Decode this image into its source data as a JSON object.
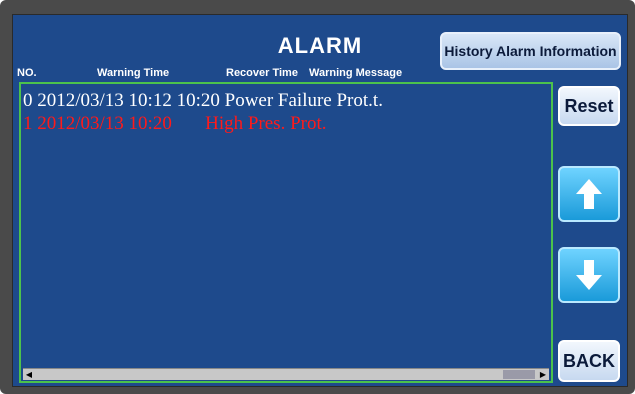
{
  "title": "ALARM",
  "history_button": "History Alarm Information",
  "columns": {
    "no": "NO.",
    "warning_time": "Warning Time",
    "recover_time": "Recover Time",
    "warning_message": "Warning Message"
  },
  "rows": [
    {
      "no": "0",
      "warning_time": "2012/03/13 10:12",
      "recover_time": "10:20",
      "message": "Power Failure Prot.t.",
      "color": "#ffffff"
    },
    {
      "no": "1",
      "warning_time": "2012/03/13 10:20",
      "recover_time": "",
      "message": "High Pres. Prot.",
      "color": "#ff1a1a"
    }
  ],
  "buttons": {
    "reset": "Reset",
    "up_icon": "arrow-up-icon",
    "down_icon": "arrow-down-icon",
    "back": "BACK"
  },
  "colors": {
    "screen_bg": "#1e4a8c",
    "list_border": "#4cc24c",
    "active_alarm": "#ff1a1a"
  }
}
